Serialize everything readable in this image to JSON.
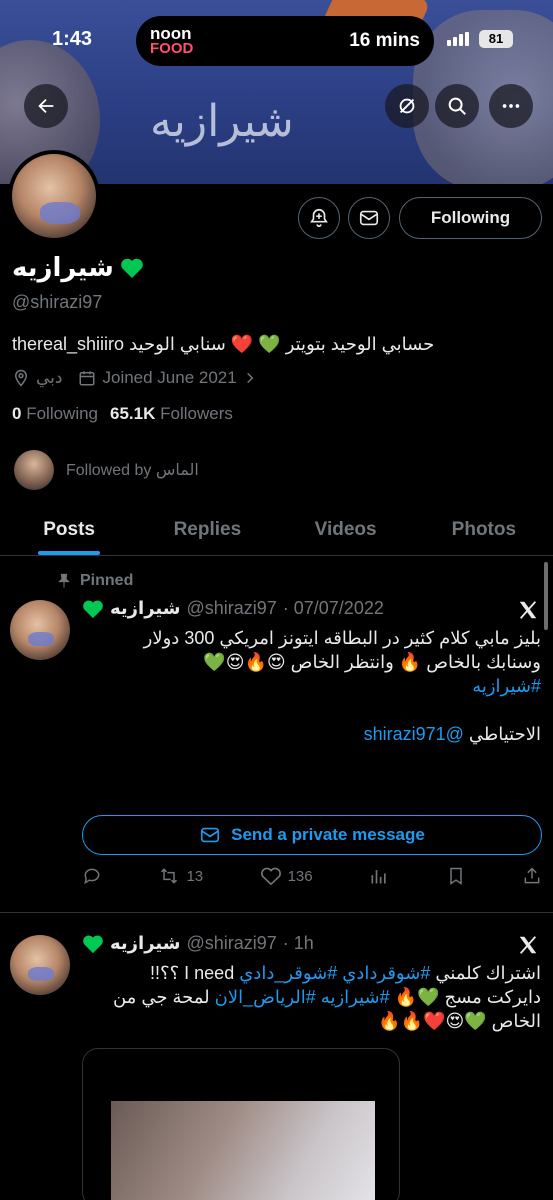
{
  "status_bar": {
    "time": "1:43",
    "live_activity_brand_top": "noon",
    "live_activity_brand_bottom": "FOOD",
    "eta": "16 mins",
    "battery": "81"
  },
  "banner": {
    "shirt_text": "شيرازيه"
  },
  "profile": {
    "display_name": "شيرازيه",
    "handle": "@shirazi97",
    "bio": "حسابي الوحيد بتويتر 💚 ❤️ سنابي الوحيد thereal_shiiiro",
    "location": "دبي",
    "joined": "Joined June 2021",
    "following_count": "0",
    "following_label": "Following",
    "followers_count": "65.1K",
    "followers_label": "Followers",
    "followed_by": "Followed by الماس",
    "follow_button": "Following"
  },
  "tabs": [
    {
      "label": "Posts"
    },
    {
      "label": "Replies"
    },
    {
      "label": "Videos"
    },
    {
      "label": "Photos"
    }
  ],
  "posts": [
    {
      "pinned_label": "Pinned",
      "name": "شيرازيه",
      "handle": "@shirazi97",
      "time": "· 07/07/2022",
      "line1": "بليز مابي كلام كثير در البطاقه ايتونز امريكي 300 دولار",
      "line2": "وسنابك بالخاص 🔥 وانتظر الخاص 😍🔥😍💚",
      "hashtag": "#شيرازيه",
      "backup_label": "الاحتياطي",
      "backup_handle": "@shirazi971",
      "dm_button": "Send a private message",
      "retweets": "13",
      "likes": "136"
    },
    {
      "name": "شيرازيه",
      "handle": "@shirazi97",
      "time": "· 1h",
      "line1_tail": "I need ؟؟!!",
      "line1_tags": "#شوقردادي #شوقر_دادي",
      "line1_head": "اشتراك كلمني",
      "line2_head": "دايركت مسج 💚🔥",
      "line2_tags": "#شيرازيه #الرياض_الان",
      "line2_tail": "لمحة جي من",
      "line3": "الخاص 💚😍❤️🔥🔥"
    }
  ],
  "colors": {
    "accent": "#1d9bf0",
    "background": "#000000",
    "muted": "#71767b",
    "heart_emoji": "#00c853"
  },
  "icons": [
    "back-arrow-icon",
    "hide-icon",
    "search-icon",
    "more-icon",
    "notification-plus-icon",
    "mail-icon",
    "location-icon",
    "calendar-icon",
    "chevron-right-icon",
    "pin-icon",
    "x-logo-icon",
    "reply-icon",
    "retweet-icon",
    "like-icon",
    "views-icon",
    "bookmark-icon",
    "share-icon"
  ]
}
